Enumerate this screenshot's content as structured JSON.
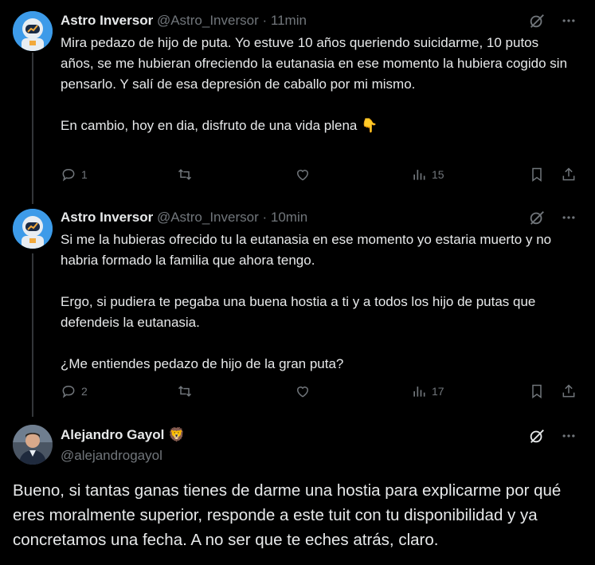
{
  "tweets": [
    {
      "name": "Astro Inversor",
      "handle": "@Astro_Inversor",
      "separator": "·",
      "time": "11min",
      "paragraphs": [
        "Mira pedazo de hijo de puta. Yo estuve 10 años queriendo suicidarme, 10 putos años, se me hubieran ofreciendo la eutanasia en ese momento la hubiera cogido sin pensarlo. Y salí de esa depresión de caballo por mi mismo.",
        "En cambio, hoy en dia, disfruto de una vida plena 👇"
      ],
      "replies": "1",
      "retweets": "",
      "likes": "",
      "views": "15"
    },
    {
      "name": "Astro Inversor",
      "handle": "@Astro_Inversor",
      "separator": "·",
      "time": "10min",
      "paragraphs": [
        "Si me la hubieras ofrecido tu la eutanasia en ese momento yo estaria muerto y no habria formado la familia que ahora tengo.",
        "Ergo, si pudiera te pegaba una buena hostia a ti y a todos los hijo de putas que defendeis la eutanasia.",
        "¿Me entiendes pedazo de hijo de la gran puta?"
      ],
      "replies": "2",
      "retweets": "",
      "likes": "",
      "views": "17"
    }
  ],
  "main": {
    "name": "Alejandro Gayol",
    "badge": "🦁",
    "handle": "@alejandrogayol",
    "text": "Bueno, si tantas ganas tienes de darme una hostia para explicarme por qué eres moralmente superior, responde a este tuit con tu disponibilidad y ya concretamos una fecha. A no ser que te eches atrás, claro."
  },
  "icons": {
    "grok": "grok-icon",
    "more": "more-icon",
    "reply": "reply-icon",
    "retweet": "retweet-icon",
    "like": "heart-icon",
    "views": "views-icon",
    "bookmark": "bookmark-icon",
    "share": "share-icon"
  },
  "colors": {
    "background": "#000000",
    "text": "#e7e9ea",
    "secondary": "#71767b",
    "thread_line": "#333639"
  }
}
